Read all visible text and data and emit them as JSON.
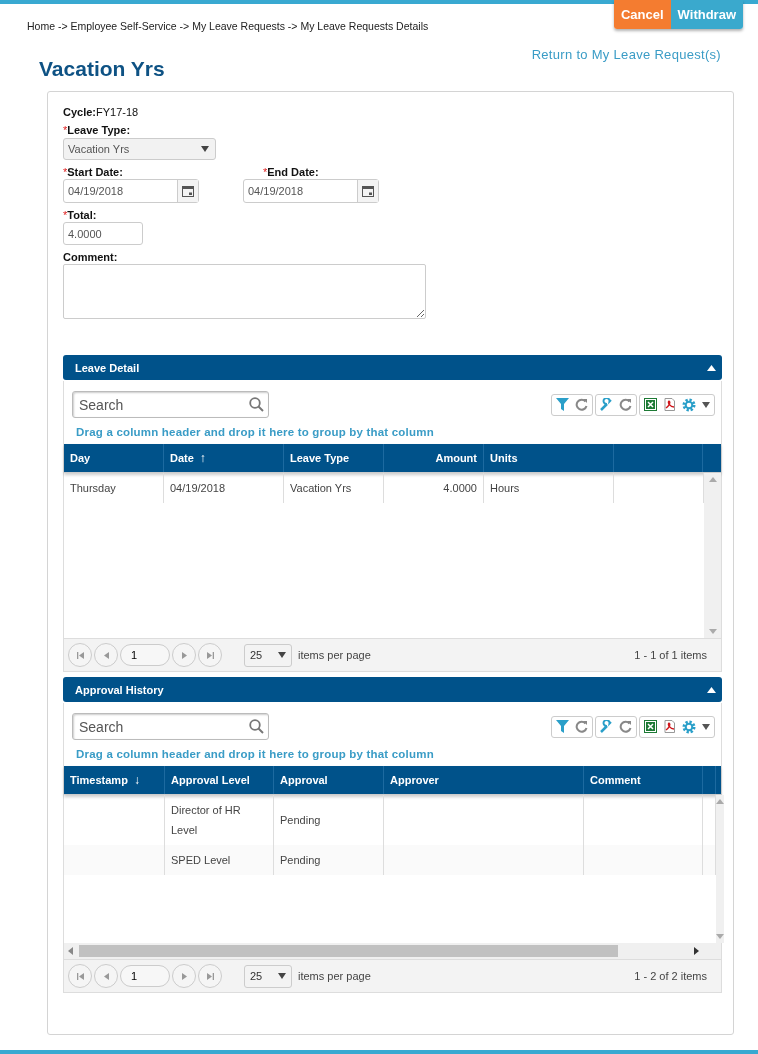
{
  "breadcrumb": "Home -> Employee Self-Service -> My Leave Requests -> My Leave Requests Details",
  "actions": [
    {
      "label": "Cancel",
      "kind": "cancel"
    },
    {
      "label": "Withdraw",
      "kind": "withdraw"
    }
  ],
  "title": "Vacation Yrs",
  "return_link": "Return to My Leave Request(s)",
  "form": {
    "cycle": {
      "label": "Cycle:",
      "value": "FY17-18"
    },
    "leave_type": {
      "mark": "*",
      "label": "Leave Type:",
      "value": "Vacation Yrs"
    },
    "start_date": {
      "mark": "*",
      "label": "Start Date:",
      "value": "04/19/2018"
    },
    "end_date": {
      "mark": "*",
      "label": "End Date:",
      "value": "04/19/2018"
    },
    "total": {
      "mark": "*",
      "label": "Total:",
      "value": "4.0000"
    },
    "comment": {
      "label": "Comment:"
    }
  },
  "sections": [
    {
      "title": "Leave Detail",
      "expanded": true,
      "search": {
        "placeholder": "Search"
      },
      "group_hint": "Drag a column header and drop it here to group by that column",
      "columns": [
        {
          "label": "Day",
          "numeric": false
        },
        {
          "label": "Date",
          "sort_mark": "↑",
          "numeric": false
        },
        {
          "label": "Leave Type",
          "numeric": false
        },
        {
          "label": "Amount",
          "numeric": true
        },
        {
          "label": "Units",
          "numeric": false
        }
      ],
      "rows": [
        [
          "Thursday",
          "04/19/2018",
          "Vacation Yrs",
          "4.0000",
          "Hours"
        ]
      ],
      "pager": {
        "page": "1",
        "page_size": "25",
        "per_page_label": "items per page",
        "summary": "1 - 1 of 1 items"
      }
    },
    {
      "title": "Approval History",
      "expanded": true,
      "search": {
        "placeholder": "Search"
      },
      "group_hint": "Drag a column header and drop it here to group by that column",
      "columns": [
        {
          "label": "Timestamp",
          "sort_mark": "↓",
          "numeric": false
        },
        {
          "label": "Approval Level",
          "numeric": false
        },
        {
          "label": "Approval",
          "numeric": false
        },
        {
          "label": "Approver",
          "numeric": false
        },
        {
          "label": "Comment",
          "numeric": false
        }
      ],
      "rows": [
        [
          "",
          "Director of HR Level",
          "Pending",
          "",
          ""
        ],
        [
          "",
          "SPED Level",
          "Pending",
          "",
          ""
        ]
      ],
      "pager": {
        "page": "1",
        "page_size": "25",
        "per_page_label": "items per page",
        "summary": "1 - 2 of 2 items"
      }
    }
  ]
}
